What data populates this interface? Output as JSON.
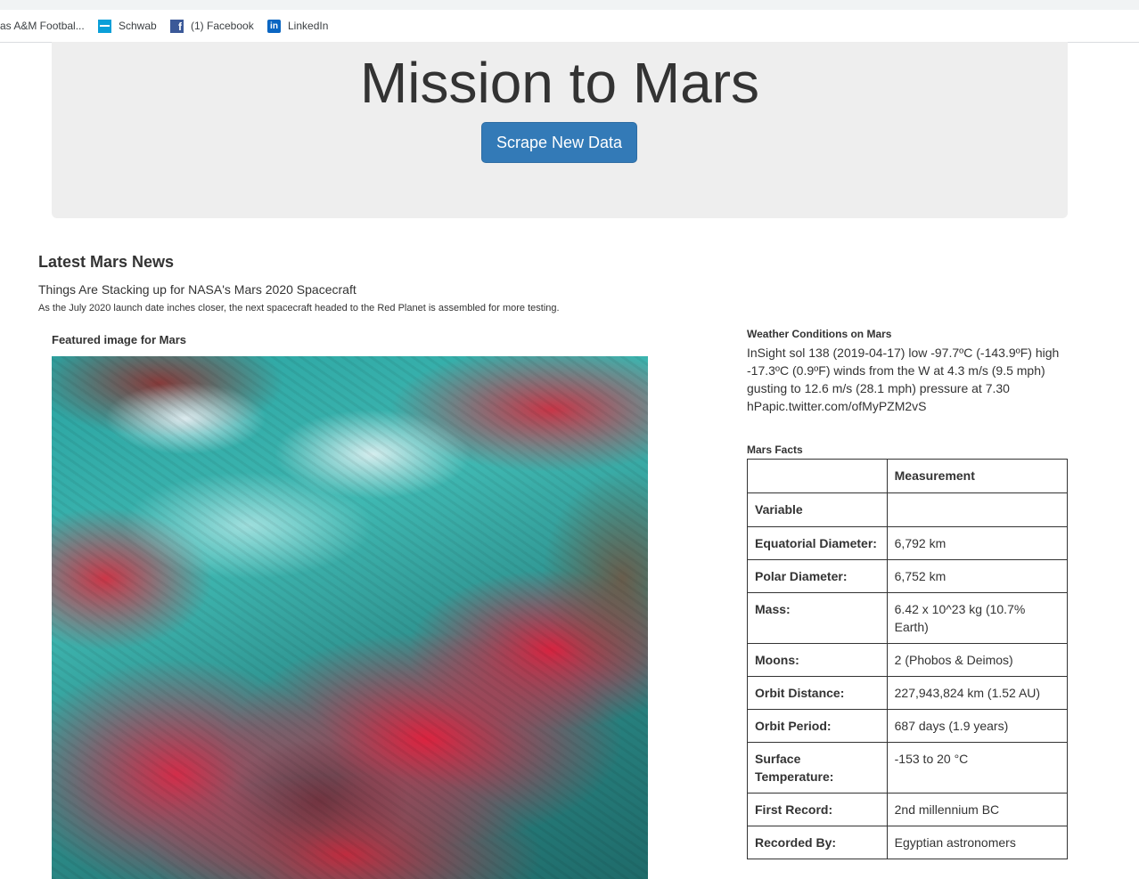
{
  "browser": {
    "bookmarks": [
      {
        "label": "as A&M Footbal...",
        "icon": "bookmark-icon"
      },
      {
        "label": "Schwab",
        "icon": "schwab-icon"
      },
      {
        "label": "(1) Facebook",
        "icon": "facebook-icon"
      },
      {
        "label": "LinkedIn",
        "icon": "linkedin-icon"
      }
    ]
  },
  "header": {
    "title": "Mission to Mars",
    "scrape_button_label": "Scrape New Data",
    "button_color": "#337ab7"
  },
  "news": {
    "heading": "Latest Mars News",
    "title": "Things Are Stacking up for NASA's Mars 2020 Spacecraft",
    "paragraph": "As the July 2020 launch date inches closer, the next spacecraft headed to the Red Planet is assembled for more testing."
  },
  "featured": {
    "heading": "Featured image for Mars"
  },
  "weather": {
    "heading": "Weather Conditions on Mars",
    "text": "InSight sol 138 (2019-04-17) low -97.7ºC (-143.9ºF) high -17.3ºC (0.9ºF) winds from the W at 4.3 m/s (9.5 mph) gusting to 12.6 m/s (28.1 mph) pressure at 7.30 hPapic.twitter.com/ofMyPZM2vS"
  },
  "facts": {
    "heading": "Mars Facts",
    "header_blank": "",
    "header_measurement": "Measurement",
    "index_label": "Variable",
    "rows": [
      {
        "label": "Equatorial Diameter:",
        "value": "6,792 km"
      },
      {
        "label": "Polar Diameter:",
        "value": "6,752 km"
      },
      {
        "label": "Mass:",
        "value": "6.42 x 10^23 kg (10.7% Earth)"
      },
      {
        "label": "Moons:",
        "value": "2 (Phobos & Deimos)"
      },
      {
        "label": "Orbit Distance:",
        "value": "227,943,824 km (1.52 AU)"
      },
      {
        "label": "Orbit Period:",
        "value": "687 days (1.9 years)"
      },
      {
        "label": "Surface Temperature:",
        "value": "-153 to 20 °C"
      },
      {
        "label": "First Record:",
        "value": "2nd millennium BC"
      },
      {
        "label": "Recorded By:",
        "value": "Egyptian astronomers"
      }
    ]
  }
}
